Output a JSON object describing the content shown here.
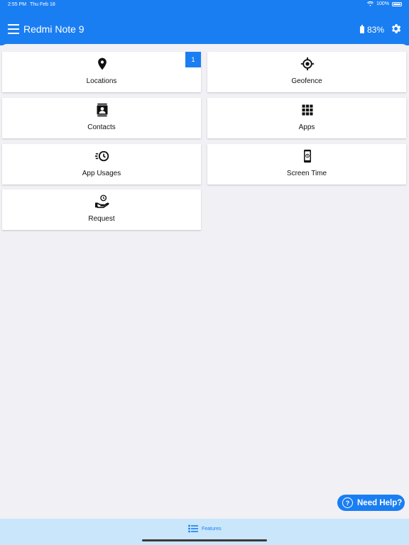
{
  "status_bar": {
    "time": "2:55 PM",
    "date": "Thu Feb 18",
    "battery_percent": "100%"
  },
  "header": {
    "title": "Redmi Note 9",
    "battery": "83%"
  },
  "features": [
    {
      "label": "Locations",
      "icon": "map-pin-icon",
      "badge": "1"
    },
    {
      "label": "Geofence",
      "icon": "target-icon"
    },
    {
      "label": "Contacts",
      "icon": "contact-book-icon"
    },
    {
      "label": "Apps",
      "icon": "apps-grid-icon"
    },
    {
      "label": "App Usages",
      "icon": "fast-clock-icon"
    },
    {
      "label": "Screen Time",
      "icon": "phone-clock-icon"
    },
    {
      "label": "Request",
      "icon": "hand-clock-icon"
    }
  ],
  "help_button": {
    "label": "Need Help?"
  },
  "tab_bar": {
    "tabs": [
      {
        "label": "Features",
        "icon": "list-icon",
        "active": true
      }
    ]
  },
  "colors": {
    "accent": "#1a7ef3",
    "background": "#f1f0f5",
    "tab_bar": "#c9e6fb"
  }
}
